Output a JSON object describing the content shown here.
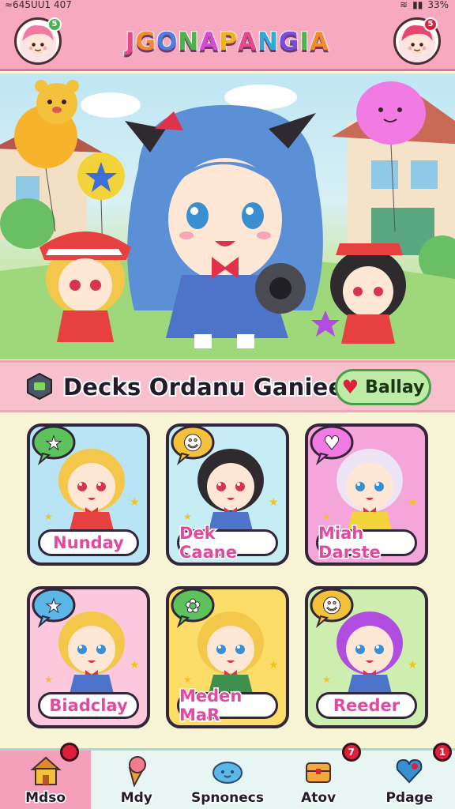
{
  "status_bar": {
    "time": "≈645UU1 407",
    "battery": "33%"
  },
  "header": {
    "title": "JGONAPANGIA",
    "title_letter_colors": [
      "#e9488b",
      "#f38a2b",
      "#4c7fe0",
      "#49b44a",
      "#d64bd1",
      "#f2b21a",
      "#e9488b",
      "#33a6d9",
      "#7a4de0",
      "#49b44a",
      "#f38a2b"
    ],
    "left_avatar_badge": "5",
    "right_avatar_badge": "5"
  },
  "section": {
    "title": "Decks Ordanu Ganiees",
    "button_label": "Ballay"
  },
  "cards": [
    {
      "label": "Nunday",
      "label_color": "#e24aa0",
      "bg": "#b9e4f6"
    },
    {
      "label": "Dek Caane",
      "label_color": "#e24aa0",
      "bg": "#c6ecf6"
    },
    {
      "label": "Miah Darste",
      "label_color": "#e24aa0",
      "bg": "#f4a6db"
    },
    {
      "label": "Biadclay",
      "label_color": "#e24aa0",
      "bg": "#fcc9dc"
    },
    {
      "label": "Meden MaR",
      "label_color": "#e24aa0",
      "bg": "#fbdd68"
    },
    {
      "label": "Reeder",
      "label_color": "#e24aa0",
      "bg": "#cdeeae"
    }
  ],
  "nav": {
    "items": [
      {
        "label": "Mdso",
        "icon": "house-icon",
        "badge": "",
        "active": true
      },
      {
        "label": "Mdy",
        "icon": "ice-cream-icon",
        "badge": "",
        "active": false
      },
      {
        "label": "Spnonecs",
        "icon": "cloud-icon",
        "badge": "",
        "active": false
      },
      {
        "label": "Atov",
        "icon": "treasure-chest-icon",
        "badge": "7",
        "active": false
      },
      {
        "label": "Pdage",
        "icon": "heart-balloon-icon",
        "badge": "1",
        "active": false
      }
    ],
    "first_badge": ""
  }
}
